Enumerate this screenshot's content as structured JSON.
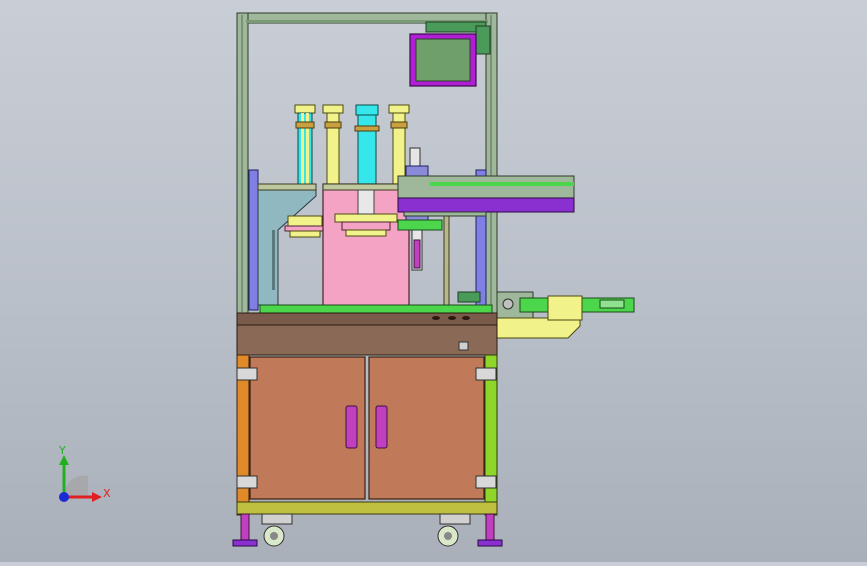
{
  "viewport": {
    "background_top": "#c9ced6",
    "background_bottom": "#a9b0ba"
  },
  "triad": {
    "x_label": "X",
    "y_label": "Y",
    "x_color": "#e02020",
    "y_color": "#20b020",
    "origin_color": "#1a2bd6"
  },
  "colors": {
    "frame": "#9fb79a",
    "cabinet": "#c07a5a",
    "handle": "#c040c0",
    "monitor_bezel": "#b01fd6",
    "monitor_screen": "#6f9f6a",
    "pink_block": "#f4a3c4",
    "cyan_cylinder": "#35e6ea",
    "yellow_plate": "#f2f28a",
    "conveyor": "#8a2fd0",
    "green_plate": "#4cd64c",
    "orange_post": "#e08a2a",
    "lime_post": "#8fd62a"
  }
}
